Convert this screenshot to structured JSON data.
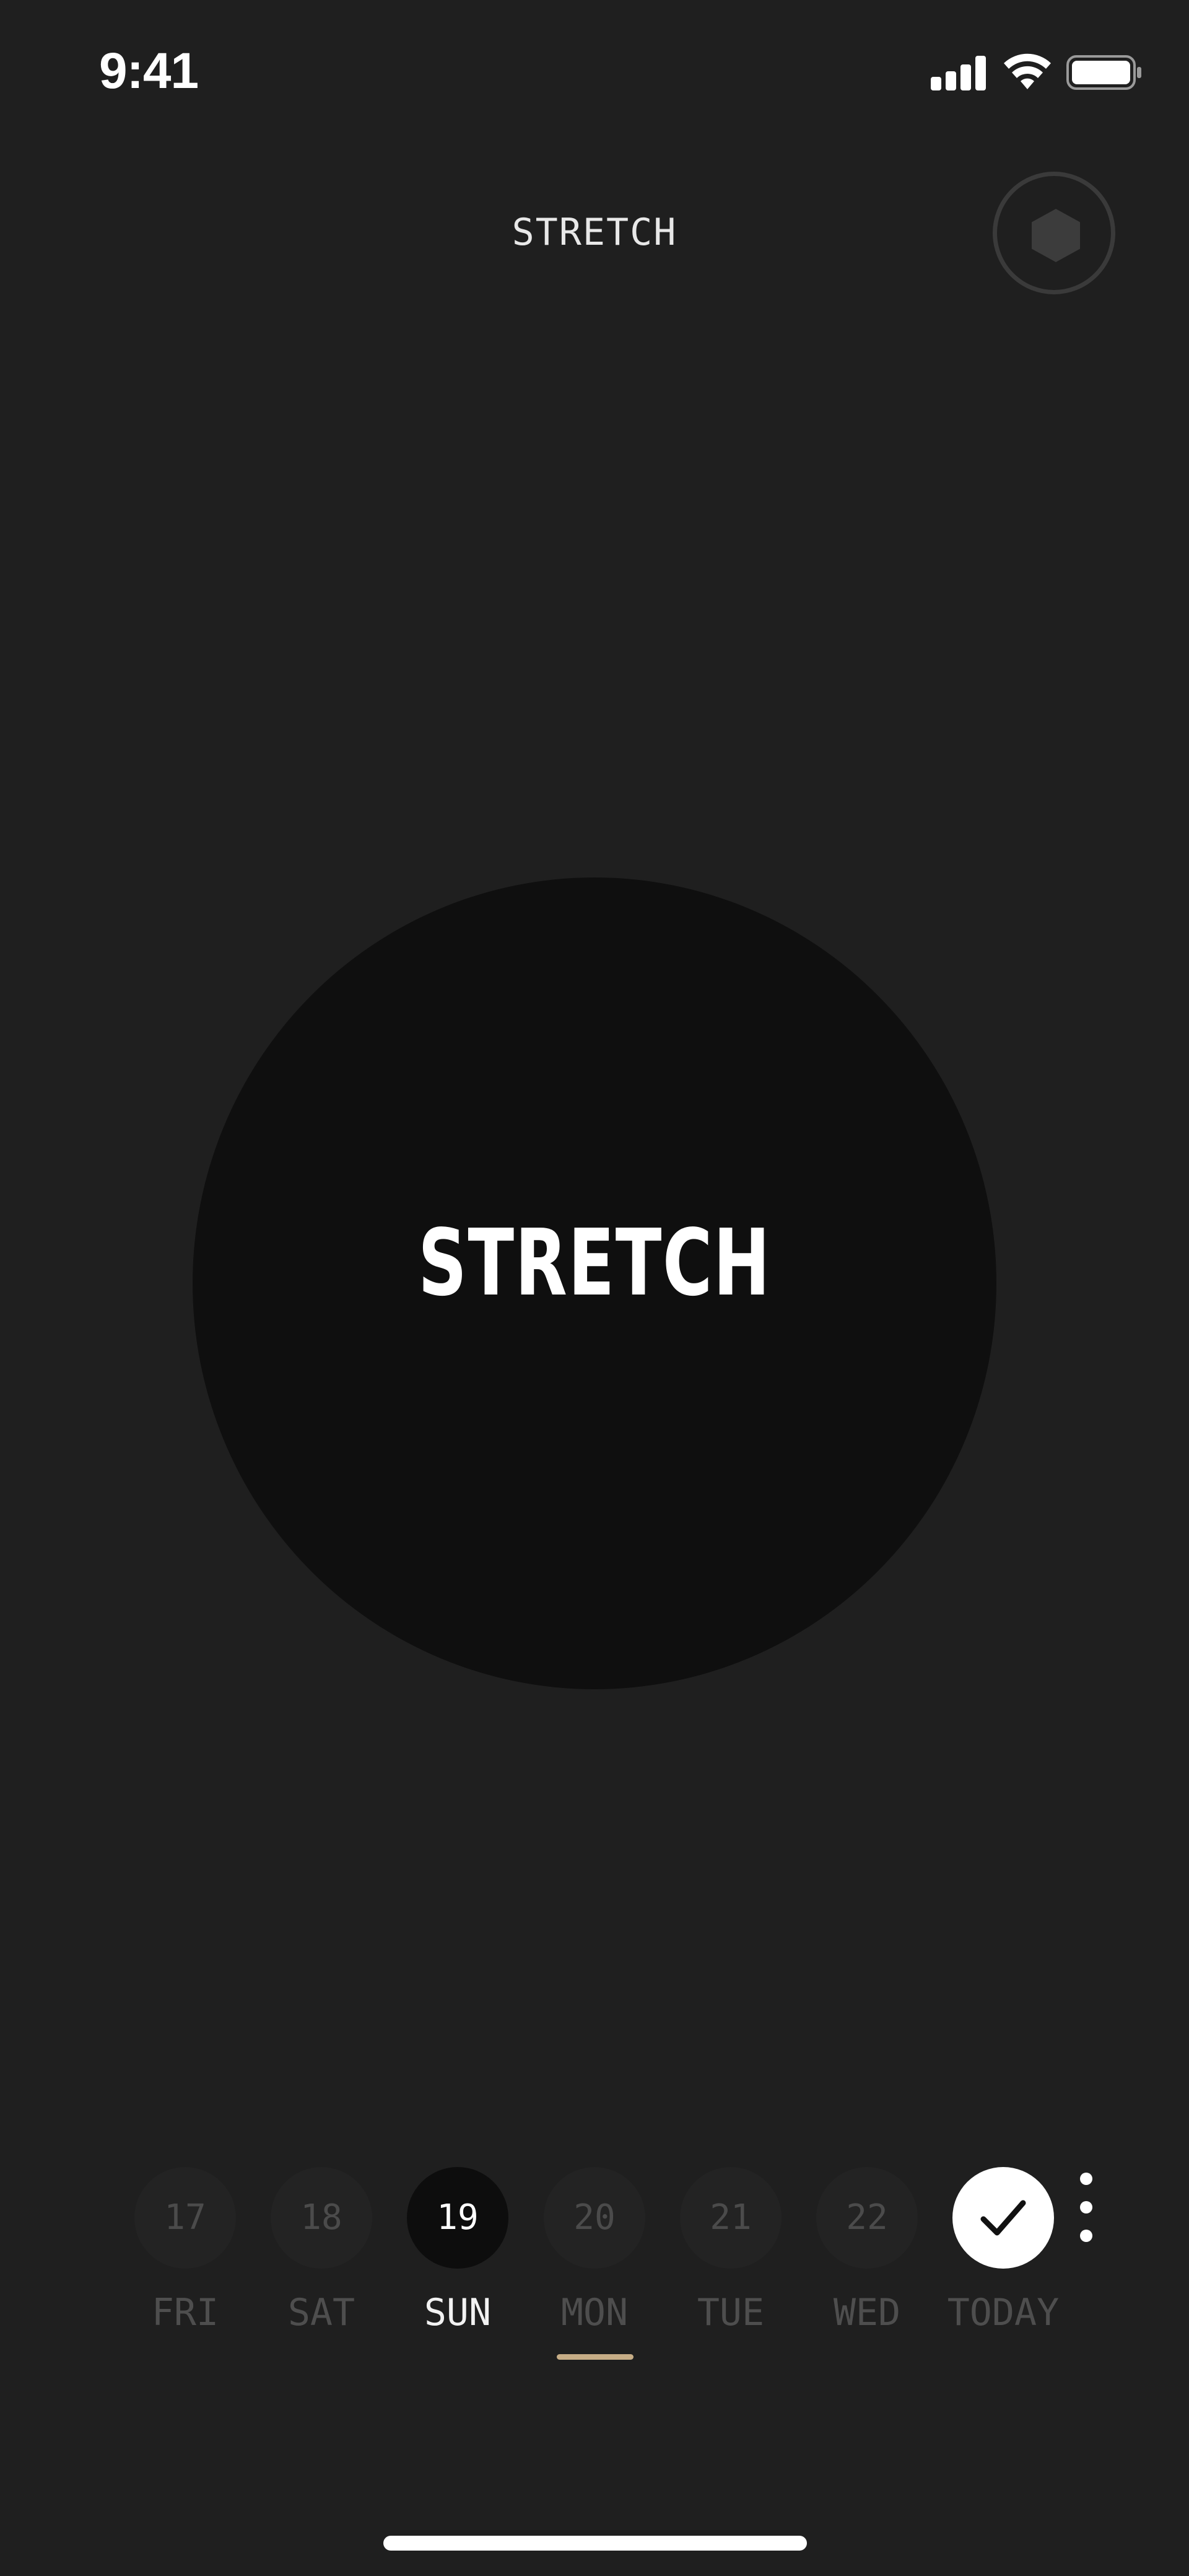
{
  "status_bar": {
    "time": "9:41",
    "signal_icon": "cellular-signal-icon",
    "wifi_icon": "wifi-icon",
    "battery_icon": "battery-icon"
  },
  "header": {
    "title": "STRETCH",
    "action_icon": "hexagon-icon"
  },
  "main": {
    "button_label": "STRETCH"
  },
  "week": {
    "days": [
      {
        "number": "17",
        "label": "FRI"
      },
      {
        "number": "18",
        "label": "SAT"
      },
      {
        "number": "19",
        "label": "SUN",
        "state": "selected"
      },
      {
        "number": "20",
        "label": "MON"
      },
      {
        "number": "21",
        "label": "TUE"
      },
      {
        "number": "22",
        "label": "WED"
      },
      {
        "number": "",
        "label": "TODAY",
        "state": "completed",
        "icon": "checkmark-icon"
      }
    ],
    "more_icon": "more-vertical-icon"
  },
  "colors": {
    "background": "#1f1f1f",
    "circle": "#0f0f0f",
    "accent_underline": "#c6ad86",
    "inactive_text": "#4e4e4e",
    "active_text": "#ffffff"
  }
}
